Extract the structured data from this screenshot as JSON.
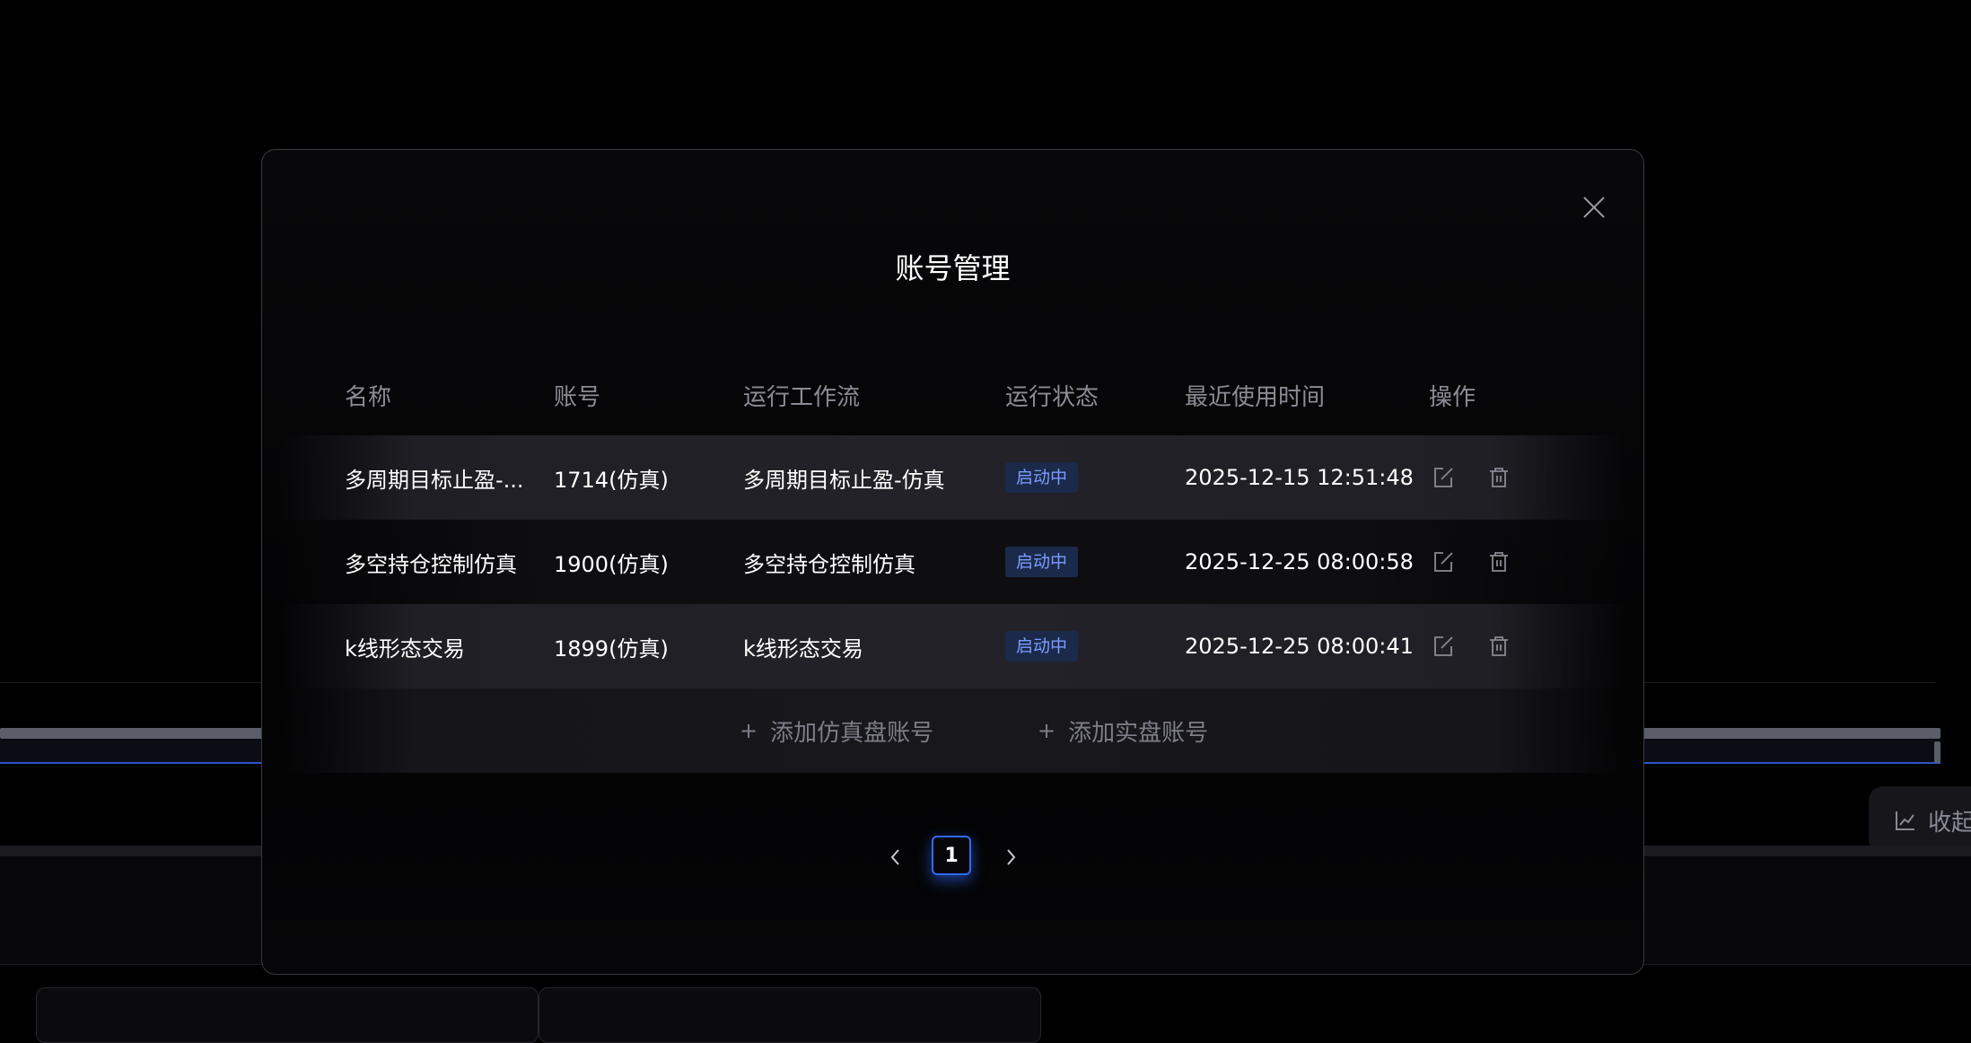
{
  "modal": {
    "title": "账号管理"
  },
  "table": {
    "headers": [
      "名称",
      "账号",
      "运行工作流",
      "运行状态",
      "最近使用时间",
      "操作"
    ],
    "rows": [
      {
        "name": "多周期目标止盈-...",
        "account": "1714(仿真)",
        "workflow": "多周期目标止盈-仿真",
        "status": "启动中",
        "last_used": "2025-12-15 12:51:48"
      },
      {
        "name": "多空持仓控制仿真",
        "account": "1900(仿真)",
        "workflow": "多空持仓控制仿真",
        "status": "启动中",
        "last_used": "2025-12-25 08:00:58"
      },
      {
        "name": "k线形态交易",
        "account": "1899(仿真)",
        "workflow": "k线形态交易",
        "status": "启动中",
        "last_used": "2025-12-25 08:00:41"
      }
    ]
  },
  "actions": {
    "plus": "+",
    "add_sim_label": "添加仿真盘账号",
    "add_real_label": "添加实盘账号"
  },
  "pagination": {
    "current_page": "1"
  },
  "background": {
    "collapse_label": "收起"
  },
  "colors": {
    "accent": "#2f6bff",
    "status_badge_bg": "#1b2a4a",
    "status_badge_text": "#7b9cff"
  },
  "icons": [
    "close-icon",
    "edit-icon",
    "delete-icon",
    "chevron-left-icon",
    "chevron-right-icon",
    "chart-line-icon"
  ]
}
